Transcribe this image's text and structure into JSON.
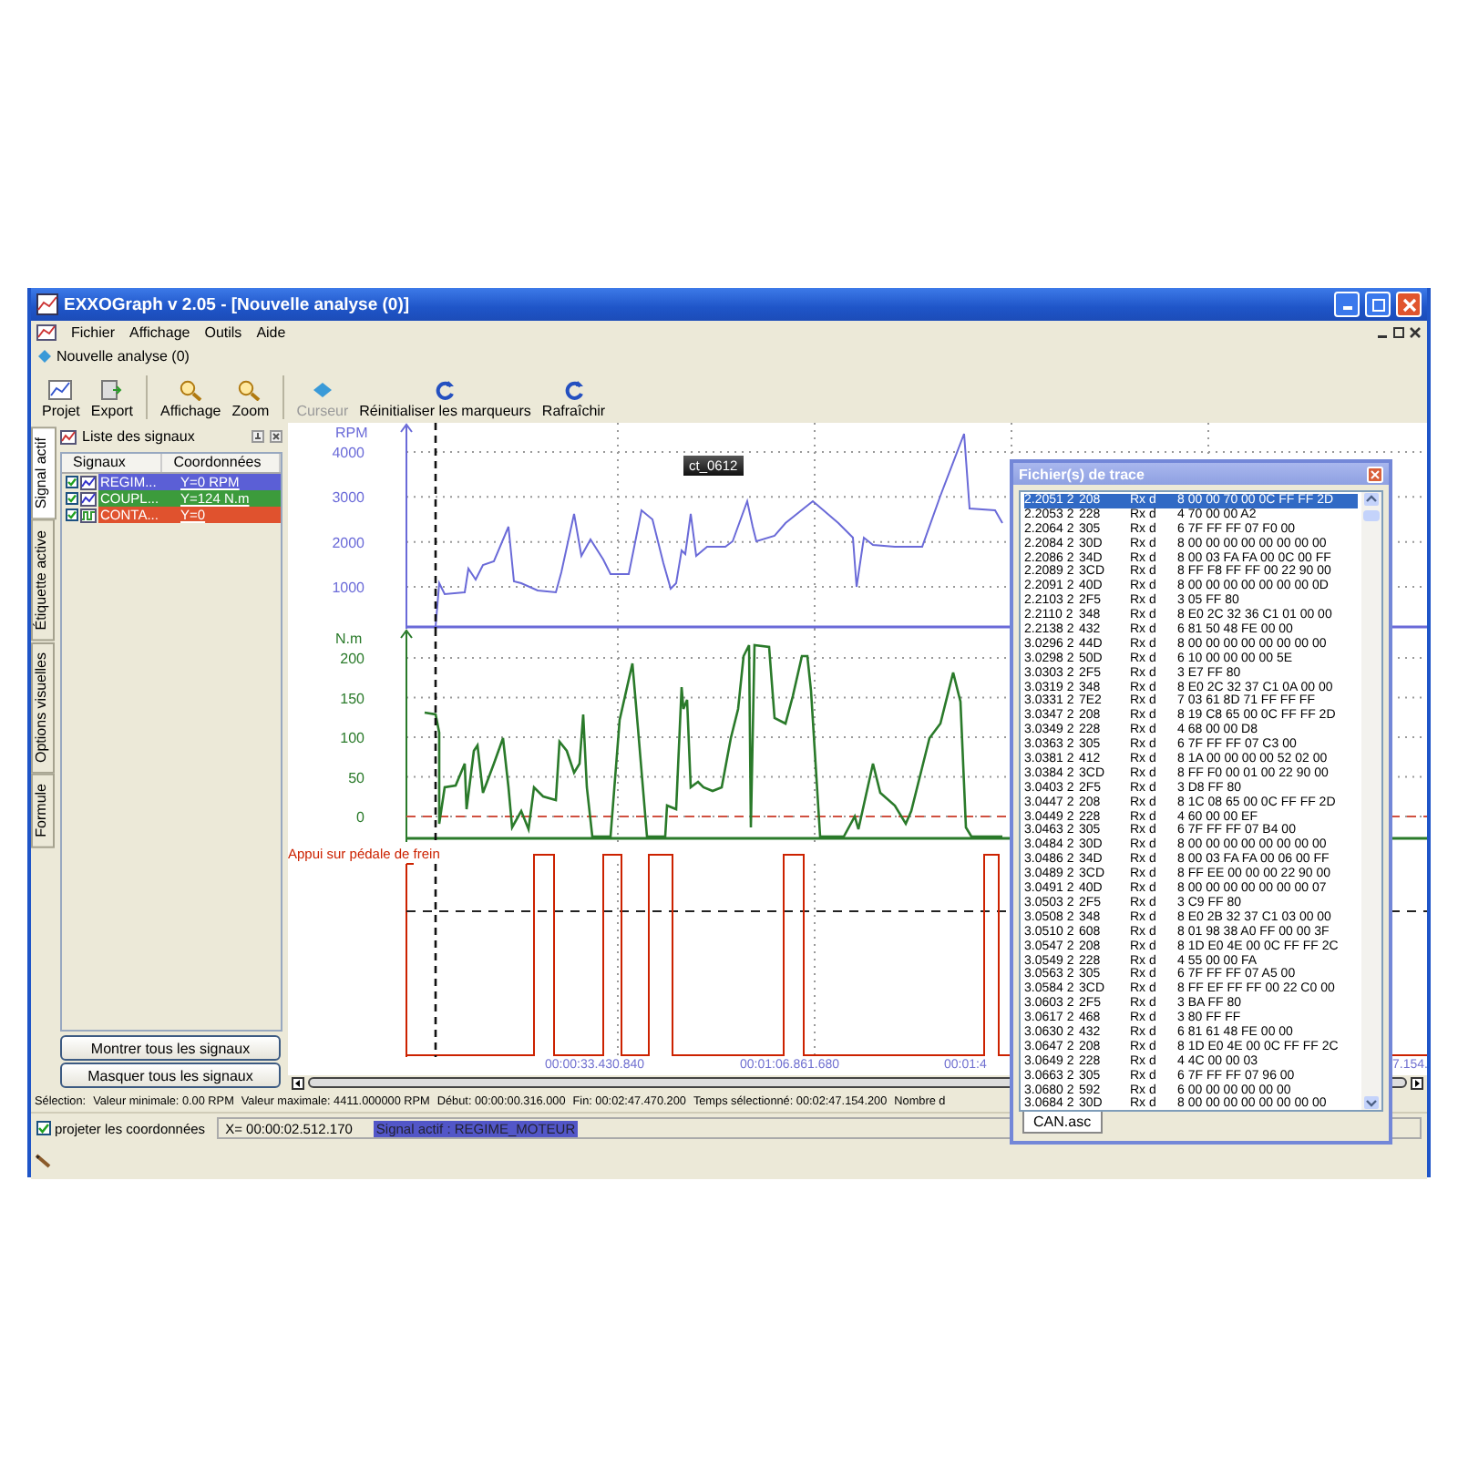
{
  "window": {
    "title": "EXXOGraph v 2.05 - [Nouvelle analyse (0)]"
  },
  "menu": [
    "Fichier",
    "Affichage",
    "Outils",
    "Aide"
  ],
  "document_tab": "Nouvelle analyse (0)",
  "toolbar": [
    [
      {
        "label": "Projet",
        "kind": "projet",
        "disabled": false
      },
      {
        "label": "Export",
        "kind": "export",
        "disabled": false
      }
    ],
    [
      {
        "label": "Affichage",
        "kind": "loupe",
        "disabled": false
      },
      {
        "label": "Zoom",
        "kind": "loupe",
        "disabled": false
      }
    ],
    [
      {
        "label": "Curseur",
        "kind": "curseur",
        "disabled": true
      },
      {
        "label": "Réinitialiser les marqueurs",
        "kind": "rafraichir",
        "disabled": false
      },
      {
        "label": "Rafraîchir",
        "kind": "rafraichir",
        "disabled": false
      }
    ]
  ],
  "side_tabs": [
    {
      "label": "Signal actif",
      "selected": true
    },
    {
      "label": "Étiquette active",
      "selected": false
    },
    {
      "label": "Options visuelles",
      "selected": false
    },
    {
      "label": "Formule",
      "selected": false
    }
  ],
  "signal_panel": {
    "title": "Liste des signaux",
    "columns": [
      "Signaux",
      "Coordonnées"
    ],
    "rows": [
      {
        "name": "REGIM...",
        "value": "Y=0 RPM",
        "checked": true,
        "kind": "analog",
        "color": "#5b5fd6"
      },
      {
        "name": "COUPL...",
        "value": "Y=124 N.m",
        "checked": true,
        "kind": "analog",
        "color": "#3c9b3c"
      },
      {
        "name": "CONTA...",
        "value": "Y=0",
        "checked": true,
        "kind": "digital",
        "color": "#e0522e"
      }
    ],
    "buttons": [
      "Montrer tous les signaux",
      "Masquer tous les signaux"
    ]
  },
  "charts": [
    {
      "unit": "RPM",
      "ticks": [
        "4000",
        "3000",
        "2000",
        "1000"
      ],
      "color": "#6a6ad8"
    },
    {
      "unit": "N.m",
      "ticks": [
        "200",
        "150",
        "100",
        "50",
        "0"
      ],
      "color": "#2a7a2a"
    },
    {
      "unit": "Appui sur pédale de frein",
      "color": "#cc2200"
    }
  ],
  "marker_label": "ct_0612",
  "time_labels": [
    "00:00:33.430.840",
    "00:01:06.861.680",
    "00:01:4",
    "7.154."
  ],
  "trace_window": {
    "title": "Fichier(s) de trace",
    "tab": "CAN.asc",
    "rows": [
      {
        "time": "2.2051 2",
        "id": "208",
        "dir": "Rx d",
        "bytes": "8 00 00 70 00 0C FF FF 2D",
        "selected": true
      },
      {
        "time": "2.2053 2",
        "id": "228",
        "dir": "Rx d",
        "bytes": "4 70 00 00 A2",
        "selected": false
      },
      {
        "time": "2.2064 2",
        "id": "305",
        "dir": "Rx d",
        "bytes": "6 7F FF FF 07 F0 00",
        "selected": false
      },
      {
        "time": "2.2084 2",
        "id": "30D",
        "dir": "Rx d",
        "bytes": "8 00 00 00 00 00 00 00 00",
        "selected": false
      },
      {
        "time": "2.2086 2",
        "id": "34D",
        "dir": "Rx d",
        "bytes": "8 00 03 FA FA 00 0C 00 FF",
        "selected": false
      },
      {
        "time": "2.2089 2",
        "id": "3CD",
        "dir": "Rx d",
        "bytes": "8 FF F8 FF FF 00 22 90 00",
        "selected": false
      },
      {
        "time": "2.2091 2",
        "id": "40D",
        "dir": "Rx d",
        "bytes": "8 00 00 00 00 00 00 00 0D",
        "selected": false
      },
      {
        "time": "2.2103 2",
        "id": "2F5",
        "dir": "Rx d",
        "bytes": "3 05 FF 80",
        "selected": false
      },
      {
        "time": "2.2110 2",
        "id": "348",
        "dir": "Rx d",
        "bytes": "8 E0 2C 32 36 C1 01 00 00",
        "selected": false
      },
      {
        "time": "2.2138 2",
        "id": "432",
        "dir": "Rx d",
        "bytes": "6 81 50 48 FE 00 00",
        "selected": false
      },
      {
        "time": "3.0296 2",
        "id": "44D",
        "dir": "Rx d",
        "bytes": "8 00 00 00 00 00 00 00 00",
        "selected": false
      },
      {
        "time": "3.0298 2",
        "id": "50D",
        "dir": "Rx d",
        "bytes": "6 10 00 00 00 00 5E",
        "selected": false
      },
      {
        "time": "3.0303 2",
        "id": "2F5",
        "dir": "Rx d",
        "bytes": "3 E7 FF 80",
        "selected": false
      },
      {
        "time": "3.0319 2",
        "id": "348",
        "dir": "Rx d",
        "bytes": "8 E0 2C 32 37 C1 0A 00 00",
        "selected": false
      },
      {
        "time": "3.0331 2",
        "id": "7E2",
        "dir": "Rx d",
        "bytes": "7 03 61 8D 71 FF FF FF",
        "selected": false
      },
      {
        "time": "3.0347 2",
        "id": "208",
        "dir": "Rx d",
        "bytes": "8 19 C8 65 00 0C FF FF 2D",
        "selected": false
      },
      {
        "time": "3.0349 2",
        "id": "228",
        "dir": "Rx d",
        "bytes": "4 68 00 00 D8",
        "selected": false
      },
      {
        "time": "3.0363 2",
        "id": "305",
        "dir": "Rx d",
        "bytes": "6 7F FF FF 07 C3 00",
        "selected": false
      },
      {
        "time": "3.0381 2",
        "id": "412",
        "dir": "Rx d",
        "bytes": "8 1A 00 00 00 00 52 02 00",
        "selected": false
      },
      {
        "time": "3.0384 2",
        "id": "3CD",
        "dir": "Rx d",
        "bytes": "8 FF F0 00 01 00 22 90 00",
        "selected": false
      },
      {
        "time": "3.0403 2",
        "id": "2F5",
        "dir": "Rx d",
        "bytes": "3 D8 FF 80",
        "selected": false
      },
      {
        "time": "3.0447 2",
        "id": "208",
        "dir": "Rx d",
        "bytes": "8 1C 08 65 00 0C FF FF 2D",
        "selected": false
      },
      {
        "time": "3.0449 2",
        "id": "228",
        "dir": "Rx d",
        "bytes": "4 60 00 00 EF",
        "selected": false
      },
      {
        "time": "3.0463 2",
        "id": "305",
        "dir": "Rx d",
        "bytes": "6 7F FF FF 07 B4 00",
        "selected": false
      },
      {
        "time": "3.0484 2",
        "id": "30D",
        "dir": "Rx d",
        "bytes": "8 00 00 00 00 00 00 00 00",
        "selected": false
      },
      {
        "time": "3.0486 2",
        "id": "34D",
        "dir": "Rx d",
        "bytes": "8 00 03 FA FA 00 06 00 FF",
        "selected": false
      },
      {
        "time": "3.0489 2",
        "id": "3CD",
        "dir": "Rx d",
        "bytes": "8 FF EE 00 00 00 22 90 00",
        "selected": false
      },
      {
        "time": "3.0491 2",
        "id": "40D",
        "dir": "Rx d",
        "bytes": "8 00 00 00 00 00 00 00 07",
        "selected": false
      },
      {
        "time": "3.0503 2",
        "id": "2F5",
        "dir": "Rx d",
        "bytes": "3 C9 FF 80",
        "selected": false
      },
      {
        "time": "3.0508 2",
        "id": "348",
        "dir": "Rx d",
        "bytes": "8 E0 2B 32 37 C1 03 00 00",
        "selected": false
      },
      {
        "time": "3.0510 2",
        "id": "608",
        "dir": "Rx d",
        "bytes": "8 01 98 38 A0 FF 00 00 3F",
        "selected": false
      },
      {
        "time": "3.0547 2",
        "id": "208",
        "dir": "Rx d",
        "bytes": "8 1D E0 4E 00 0C FF FF 2C",
        "selected": false
      },
      {
        "time": "3.0549 2",
        "id": "228",
        "dir": "Rx d",
        "bytes": "4 55 00 00 FA",
        "selected": false
      },
      {
        "time": "3.0563 2",
        "id": "305",
        "dir": "Rx d",
        "bytes": "6 7F FF FF 07 A5 00",
        "selected": false
      },
      {
        "time": "3.0584 2",
        "id": "3CD",
        "dir": "Rx d",
        "bytes": "8 FF EF FF FF 00 22 C0 00",
        "selected": false
      },
      {
        "time": "3.0603 2",
        "id": "2F5",
        "dir": "Rx d",
        "bytes": "3 BA FF 80",
        "selected": false
      },
      {
        "time": "3.0617 2",
        "id": "468",
        "dir": "Rx d",
        "bytes": "3 80 FF FF",
        "selected": false
      },
      {
        "time": "3.0630 2",
        "id": "432",
        "dir": "Rx d",
        "bytes": "6 81 61 48 FE 00 00",
        "selected": false
      },
      {
        "time": "3.0647 2",
        "id": "208",
        "dir": "Rx d",
        "bytes": "8 1D E0 4E 00 0C FF FF 2C",
        "selected": false
      },
      {
        "time": "3.0649 2",
        "id": "228",
        "dir": "Rx d",
        "bytes": "4 4C 00 00 03",
        "selected": false
      },
      {
        "time": "3.0663 2",
        "id": "305",
        "dir": "Rx d",
        "bytes": "6 7F FF FF 07 96 00",
        "selected": false
      },
      {
        "time": "3.0680 2",
        "id": "592",
        "dir": "Rx d",
        "bytes": "6 00 00 00 00 00 00",
        "selected": false
      },
      {
        "time": "3.0684 2",
        "id": "30D",
        "dir": "Rx d",
        "bytes": "8 00 00 00 00 00 00 00 00",
        "selected": false
      }
    ]
  },
  "status_bar": [
    "Sélection:",
    "Valeur minimale: 0.00 RPM",
    "Valeur maximale: 4411.000000 RPM",
    "Début: 00:00:00.316.000",
    "Fin: 00:02:47.470.200",
    "Temps sélectionné: 00:02:47.154.200",
    "Nombre d"
  ],
  "bottom_bar": {
    "checkbox": {
      "label": "projeter les coordonnées",
      "checked": true
    },
    "x_field": "X= 00:00:02.512.170",
    "active_signal": "Signal actif : REGIME_MOTEUR"
  }
}
